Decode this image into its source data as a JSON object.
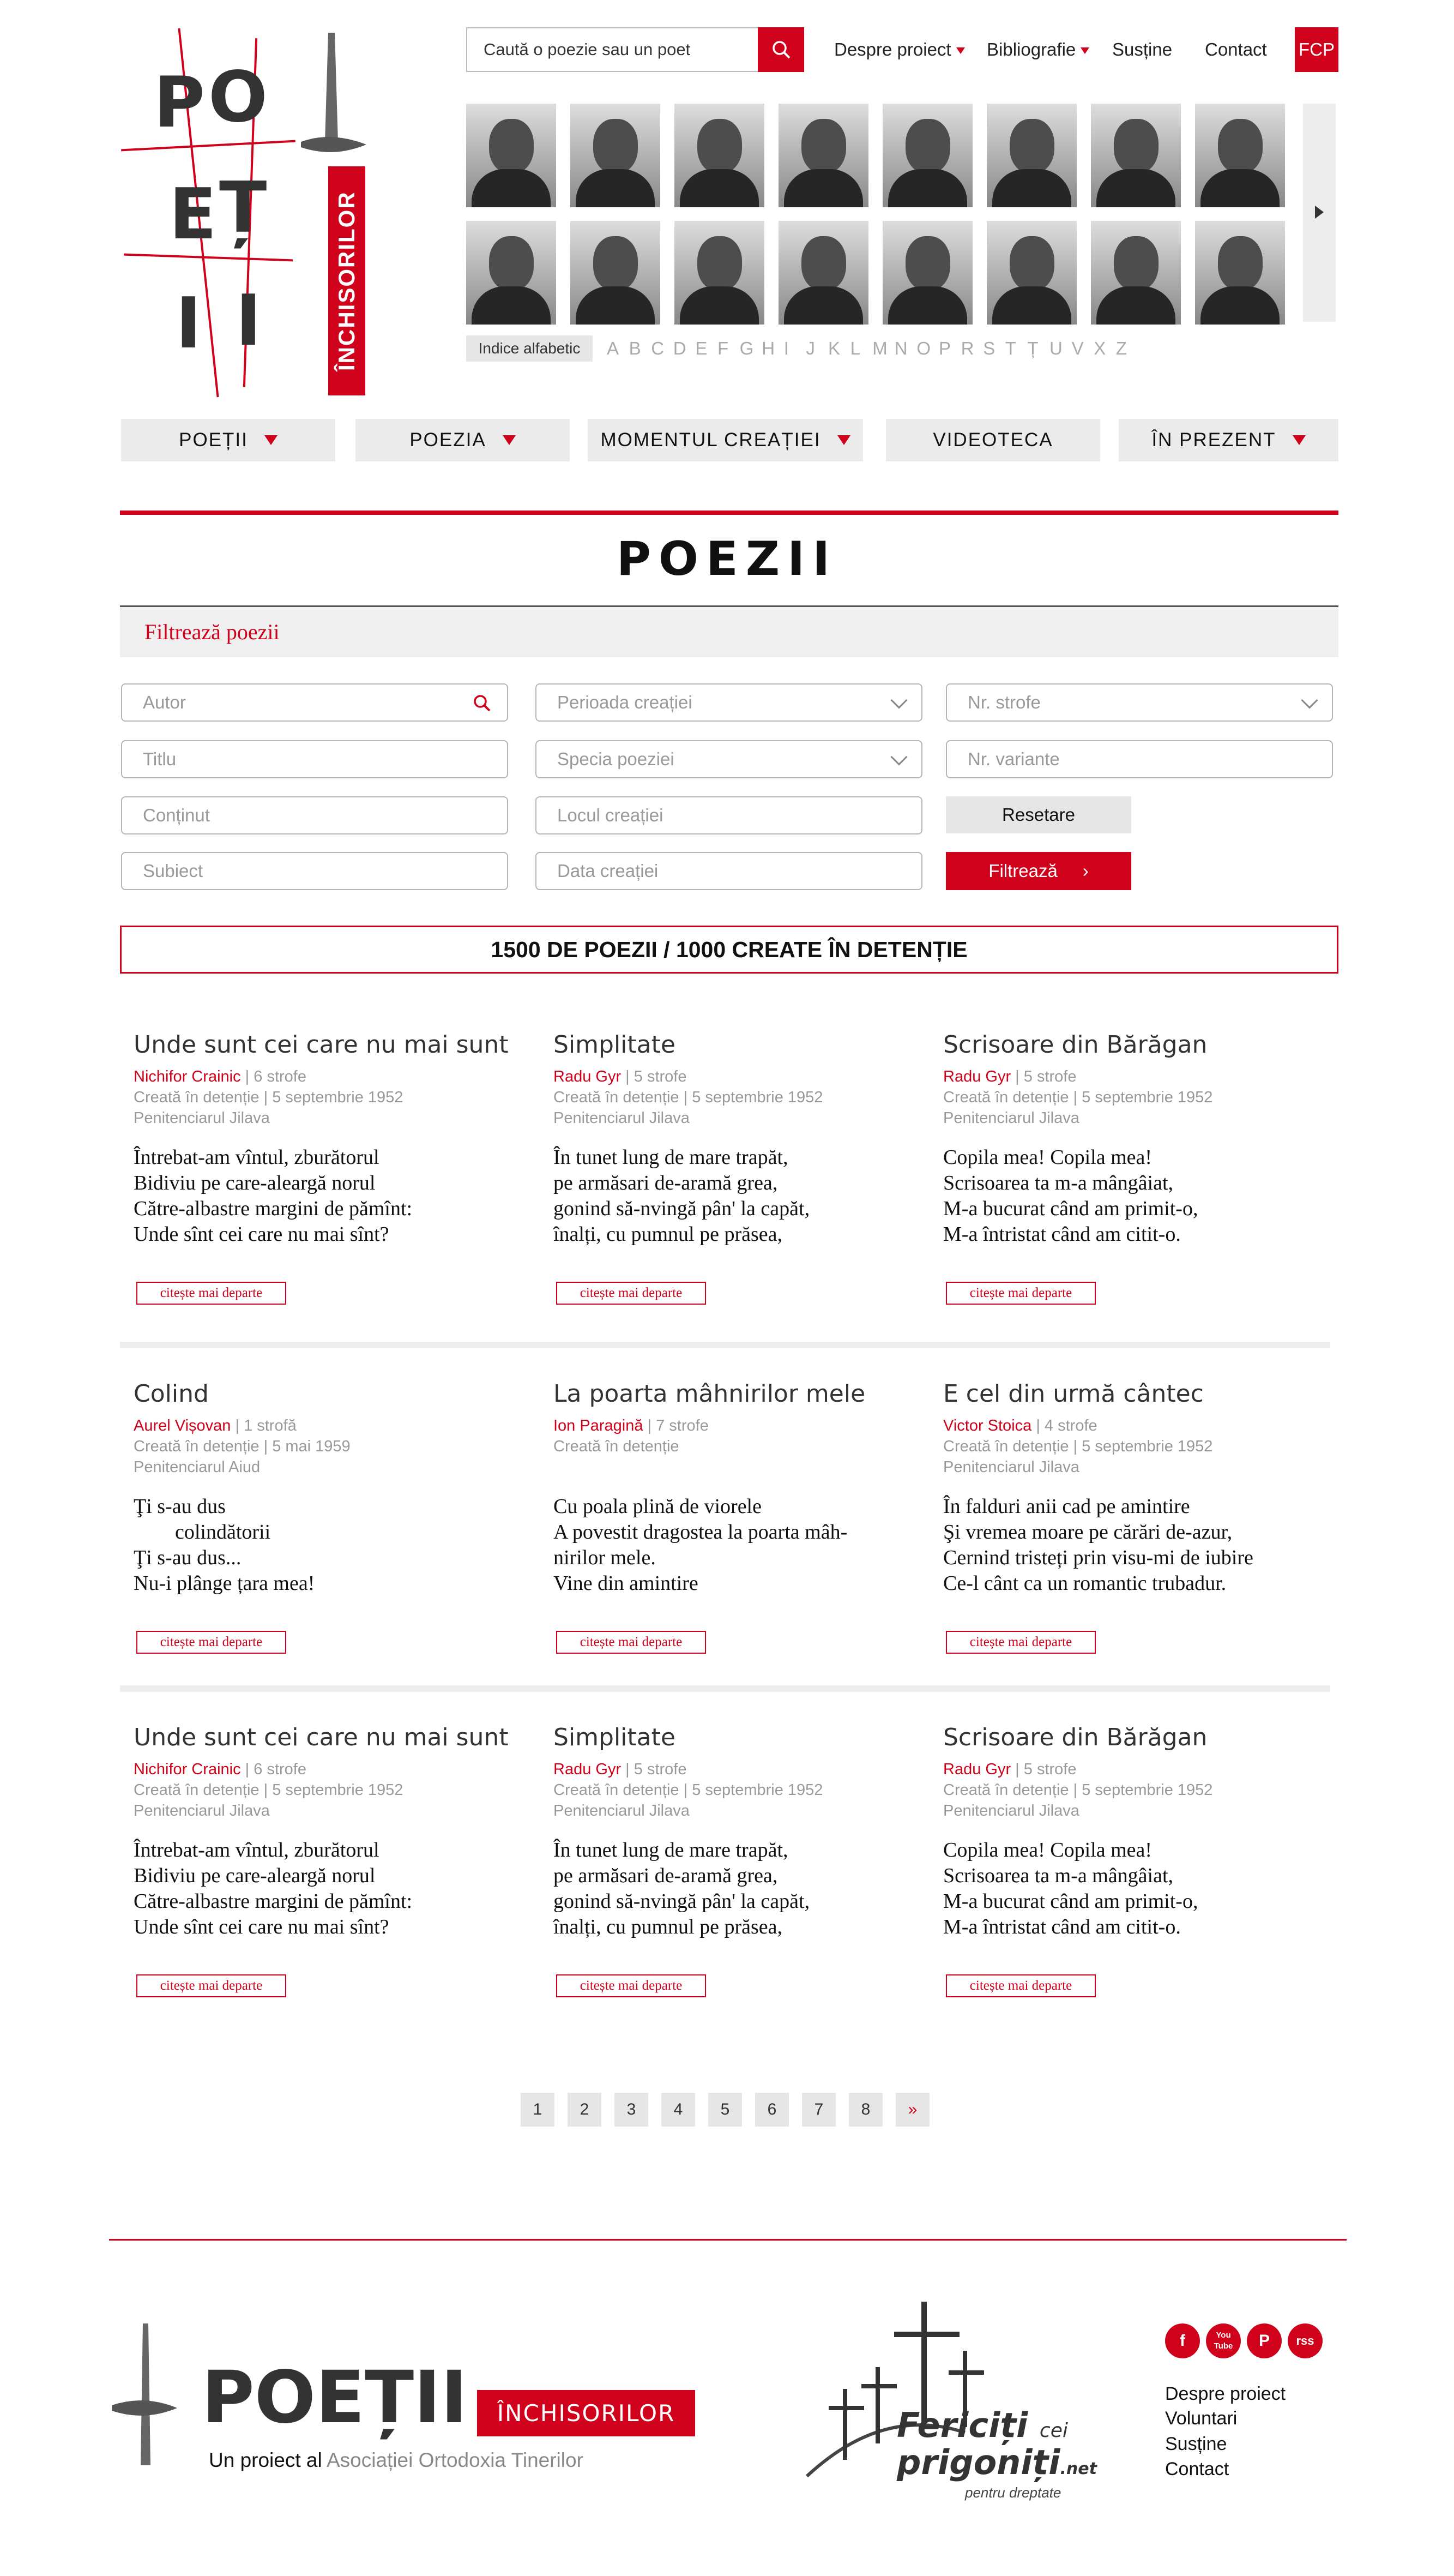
{
  "logo": {
    "letters": [
      "P",
      "O",
      "E",
      "Ț",
      "I",
      "I"
    ],
    "banner": "ÎNCHISORILOR"
  },
  "search": {
    "placeholder": "Caută o poezie sau un poet"
  },
  "topnav": {
    "despre": "Despre proiect",
    "bibliografie": "Bibliografie",
    "sustine": "Susține",
    "contact": "Contact",
    "fcp": "FCP"
  },
  "indice": "Indice alfabetic",
  "alphabet": [
    "A",
    "B",
    "C",
    "D",
    "E",
    "F",
    "G",
    "H",
    "I",
    "J",
    "K",
    "L",
    "M",
    "N",
    "O",
    "P",
    "R",
    "S",
    "T",
    "Ț",
    "U",
    "V",
    "X",
    "Z"
  ],
  "mainnav": [
    "POEȚII",
    "POEZIA",
    "MOMENTUL CREAȚIEI",
    "VIDEOTECA",
    "ÎN PREZENT"
  ],
  "page_title": "POEZII",
  "filter": {
    "title": "Filtrează poezii",
    "autor": "Autor",
    "perioada": "Perioada creației",
    "strofe": "Nr. strofe",
    "titlu": "Titlu",
    "specia": "Specia poeziei",
    "variante": "Nr. variante",
    "continut": "Conținut",
    "locul": "Locul creației",
    "reset": "Resetare",
    "subiect": "Subiect",
    "data": "Data creației",
    "filter": "Filtrează"
  },
  "count": "1500 DE POEZII / 1000 CREATE ÎN DETENȚIE",
  "read_more": "citește mai departe",
  "cards": [
    {
      "title": "Unde sunt cei care nu mai sunt",
      "author": "Nichifor Crainic",
      "strofe": "6 strofe",
      "created": "Creată în detenție | 5 septembrie 1952",
      "place": "Penitenciarul Jilava",
      "verse": "Întrebat-am vîntul, zburătorul\nBidiviu pe care-aleargă norul\nCătre-albastre margini de pămînt:\nUnde sînt cei care nu mai sînt?"
    },
    {
      "title": "Simplitate",
      "author": "Radu Gyr",
      "strofe": "5 strofe",
      "created": "Creată în detenție | 5 septembrie 1952",
      "place": "Penitenciarul Jilava",
      "verse": "În tunet lung de mare trapăt,\npe armăsari de-aramă grea,\ngonind să-nvingă pân' la capăt,\nînalți, cu pumnul pe prăsea,"
    },
    {
      "title": "Scrisoare din Bărăgan",
      "author": "Radu Gyr",
      "strofe": "5 strofe",
      "created": "Creată în detenție | 5 septembrie 1952",
      "place": "Penitenciarul Jilava",
      "verse": "Copila mea! Copila mea!\nScrisoarea ta m-a mângâiat,\nM-a bucurat când am primit-o,\nM-a întristat când am citit-o."
    },
    {
      "title": "Colind",
      "author": "Aurel Vișovan",
      "strofe": "1 strofă",
      "created": "Creată în detenție | 5 mai 1959",
      "place": "Penitenciarul Aiud",
      "verse": "Ţi s-au dus\n        colindătorii\nŢi s-au dus...\nNu-i plânge țara mea!"
    },
    {
      "title": "La poarta mâhnirilor mele",
      "author": "Ion Paragină",
      "strofe": "7 strofe",
      "created": "Creată în detenție",
      "place": "",
      "verse": "Cu poala plină de viorele\nA povestit dragostea la poarta mâh-\nnirilor mele.\nVine din amintire"
    },
    {
      "title": "E cel din urmă cântec",
      "author": "Victor Stoica",
      "strofe": "4 strofe",
      "created": "Creată în detenție | 5 septembrie 1952",
      "place": "Penitenciarul Jilava",
      "verse": "În falduri anii cad pe amintire\nŞi vremea moare pe cărări de-azur,\nCernind tristeți prin visu-mi de iubire\nCe-l cânt ca un romantic trubadur."
    },
    {
      "title": "Unde sunt cei care nu mai sunt",
      "author": "Nichifor Crainic",
      "strofe": "6 strofe",
      "created": "Creată în detenție | 5 septembrie 1952",
      "place": "Penitenciarul Jilava",
      "verse": "Întrebat-am vîntul, zburătorul\nBidiviu pe care-aleargă norul\nCătre-albastre margini de pămînt:\nUnde sînt cei care nu mai sînt?"
    },
    {
      "title": "Simplitate",
      "author": "Radu Gyr",
      "strofe": "5 strofe",
      "created": "Creată în detenție | 5 septembrie 1952",
      "place": "Penitenciarul Jilava",
      "verse": "În tunet lung de mare trapăt,\npe armăsari de-aramă grea,\ngonind să-nvingă pân' la capăt,\nînalți, cu pumnul pe prăsea,"
    },
    {
      "title": "Scrisoare din Bărăgan",
      "author": "Radu Gyr",
      "strofe": "5 strofe",
      "created": "Creată în detenție | 5 septembrie 1952",
      "place": "Penitenciarul Jilava",
      "verse": "Copila mea! Copila mea!\nScrisoarea ta m-a mângâiat,\nM-a bucurat când am primit-o,\nM-a întristat când am citit-o."
    }
  ],
  "pagination": [
    "1",
    "2",
    "3",
    "4",
    "5",
    "6",
    "7",
    "8",
    "»"
  ],
  "footer": {
    "logo_word": "POEȚII",
    "logo_banner": "ÎNCHISORILOR",
    "tagline_prefix": "Un proiect al",
    "tagline_org": "Asociației Ortodoxia Tinerilor",
    "fericiti_1": "Fericiți",
    "fericiti_cei": "cei",
    "fericiti_2": "prigoniți",
    "fericiti_net": ".net",
    "fericiti_sub": "pentru dreptate",
    "social": [
      "f",
      "You Tube",
      "P",
      "rss"
    ],
    "links": [
      "Despre proiect",
      "Voluntari",
      "Susține",
      "Contact"
    ]
  },
  "colors": {
    "accent": "#d0021b"
  }
}
